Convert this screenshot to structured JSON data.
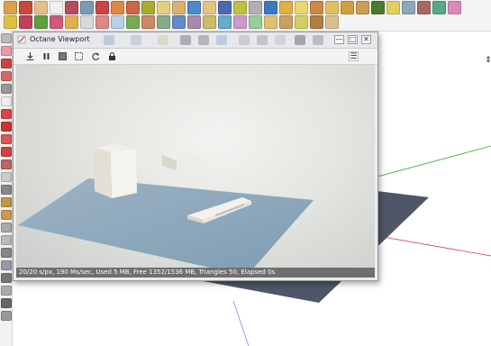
{
  "window": {
    "title": "Octane Viewport"
  },
  "statusbar": {
    "text": "20/20 s/px, 190 Ms/sec, Used 5 MB, Free 1352/1536 MB, Triangles 50, Elapsed 0s"
  },
  "icons": {
    "minimize": "minimize-icon",
    "maximize": "maximize-icon",
    "close": "close-icon",
    "menu": "menu-icon",
    "save": "download-icon",
    "pause": "pause-icon",
    "region": "region-select-icon",
    "refresh": "refresh-icon",
    "lock": "lock-icon"
  },
  "colors": {
    "status_bar": "#6f6f6f",
    "ground_plane": "#87a3b8",
    "axis_green": "#3aa63a",
    "axis_red": "#d04040"
  },
  "glyphs": {
    "minimize": "—",
    "maximize": "□",
    "close": "✕",
    "menu": "☰"
  }
}
